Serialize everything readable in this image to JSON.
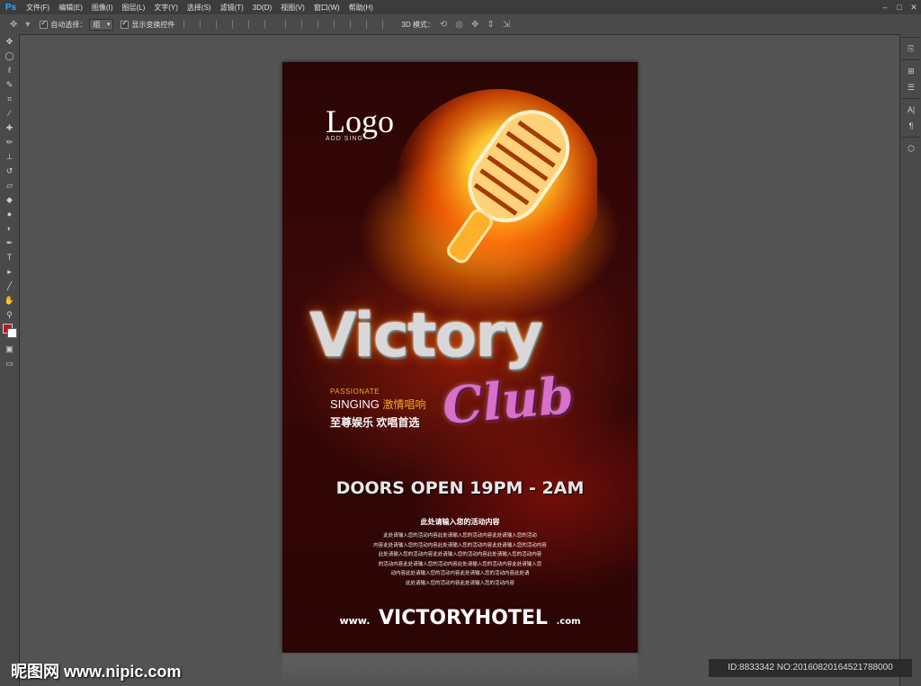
{
  "app": {
    "logo": "Ps"
  },
  "menu": [
    "文件(F)",
    "编辑(E)",
    "图像(I)",
    "图层(L)",
    "文字(Y)",
    "选择(S)",
    "滤镜(T)",
    "3D(D)",
    "视图(V)",
    "窗口(W)",
    "帮助(H)"
  ],
  "window_controls": [
    "–",
    "□",
    "✕"
  ],
  "options_bar": {
    "auto_select_label": "自动选择：",
    "auto_select_value": "组",
    "show_transform_label": "显示变换控件",
    "mode_3d_label": "3D 模式："
  },
  "tools": [
    "move-tool",
    "marquee-tool",
    "lasso-tool",
    "quick-select-tool",
    "crop-tool",
    "eyedropper-tool",
    "healing-tool",
    "brush-tool",
    "stamp-tool",
    "history-brush-tool",
    "eraser-tool",
    "gradient-tool",
    "blur-tool",
    "dodge-tool",
    "pen-tool",
    "type-tool",
    "path-select-tool",
    "line-tool",
    "hand-tool",
    "zoom-tool"
  ],
  "colors": {
    "foreground": "#b31d1d",
    "background": "#ffffff"
  },
  "poster": {
    "logo": "Logo",
    "logo_sub": "ADD SING",
    "headline": "Victory",
    "subheadline": "Club",
    "passionate": "PASSIONATE",
    "singing": "SINGING",
    "singing_cn": "激情唱响",
    "slogan": "至尊娱乐  欢唱首选",
    "doors": "DOORS OPEN 19PM - 2AM",
    "body_title": "此处请输入您的活动内容",
    "body_lines": [
      "此处请输入您的活动内容此处请输入您的活动内容此处请输入您的活动",
      "内容此处请输入您的活动内容此处请输入您的活动内容此处请输入您的活动内容",
      "此处请输入您的活动内容此处请输入您的活动内容此处请输入您的活动内容",
      "的活动内容此处请输入您的活动内容此处请输入您的活动内容此处请输入您",
      "动内容此处请输入您的活动内容此处请输入您的活动内容此处请",
      "此处请输入您的活动内容此处请输入您的活动内容"
    ],
    "web_www": "www.",
    "web_main": "VICTORYHOTEL",
    "web_com": ".com"
  },
  "watermark": {
    "left": "昵图网 www.nipic.com",
    "right": "ID:8833342 NO:20160820164521788000"
  }
}
